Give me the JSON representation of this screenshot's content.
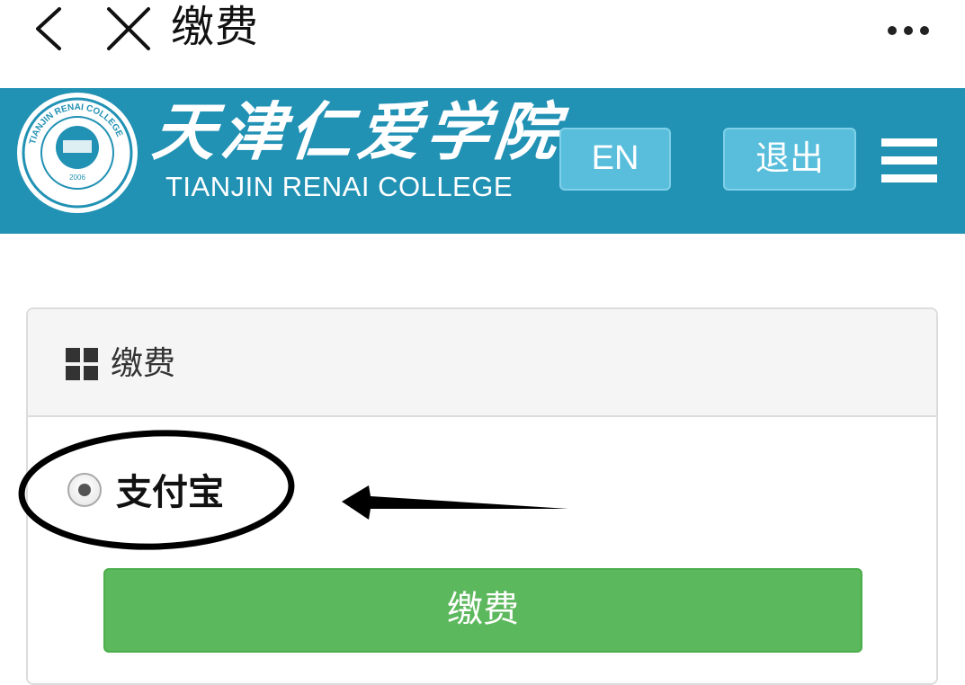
{
  "appbar": {
    "title": "缴费"
  },
  "header": {
    "brand_cn": "天津仁爱学院",
    "brand_en": "TIANJIN RENAI COLLEGE",
    "lang_button": "EN",
    "logout_button": "退出"
  },
  "panel": {
    "heading": "缴费",
    "payment_option": "支付宝",
    "payment_selected": true,
    "submit_label": "缴费"
  },
  "colors": {
    "header_bg": "#2191b4",
    "header_button": "#58bedc",
    "submit_green": "#5cb85c"
  }
}
